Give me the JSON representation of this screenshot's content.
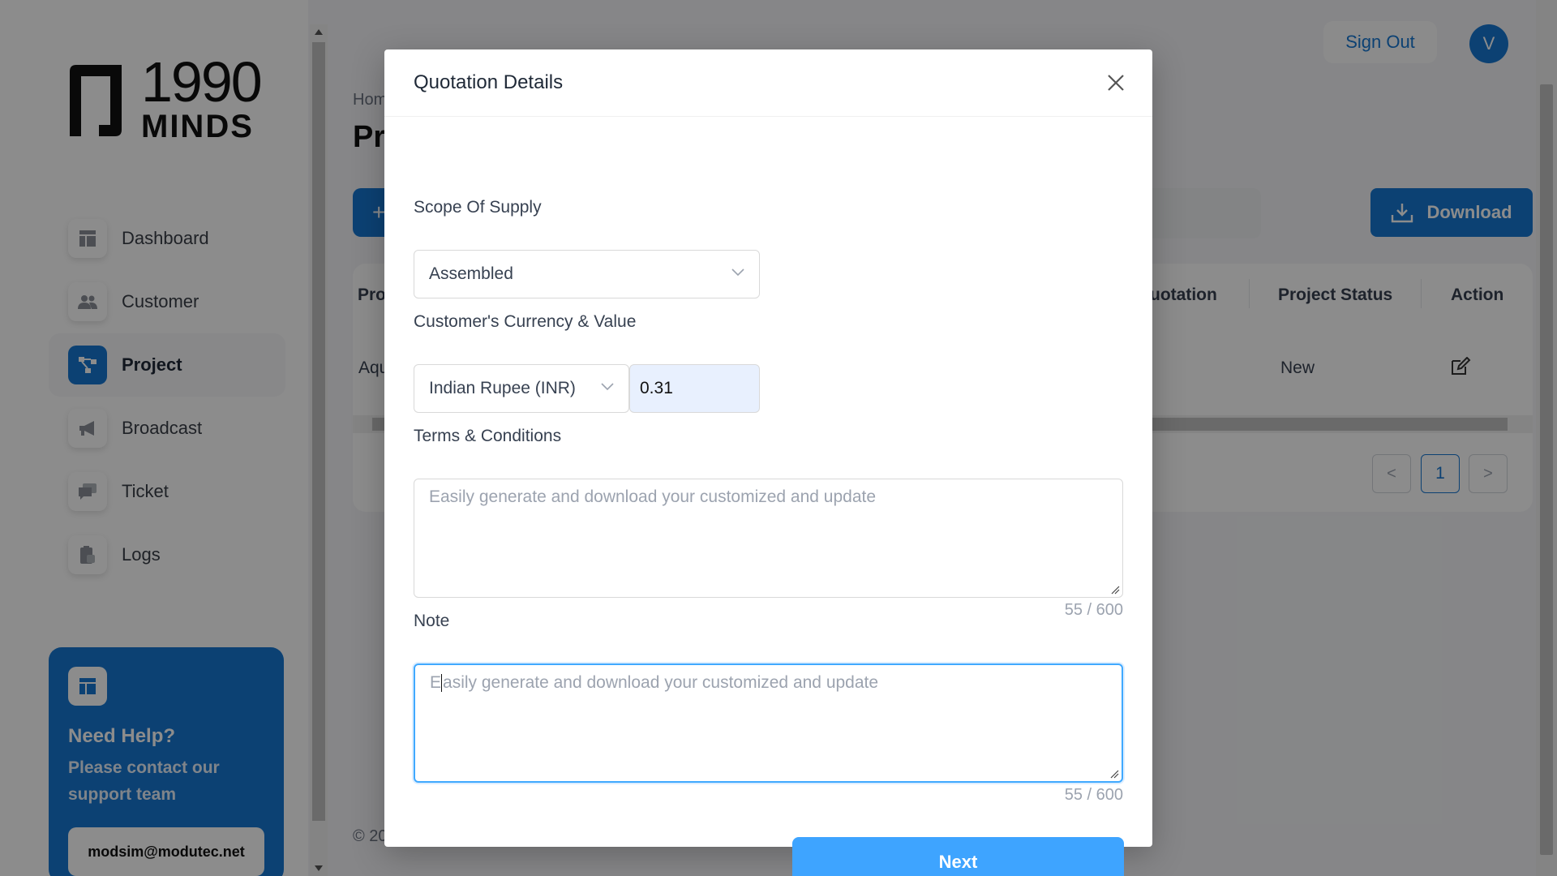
{
  "app": {
    "logo": {
      "number": "1990",
      "word": "MINDS"
    },
    "sidebar": {
      "items": [
        {
          "label": "Dashboard",
          "icon": "dashboard-icon",
          "active": false
        },
        {
          "label": "Customer",
          "icon": "users-icon",
          "active": false
        },
        {
          "label": "Project",
          "icon": "project-tree-icon",
          "active": true
        },
        {
          "label": "Broadcast",
          "icon": "megaphone-icon",
          "active": false
        },
        {
          "label": "Ticket",
          "icon": "chat-icon",
          "active": false
        },
        {
          "label": "Logs",
          "icon": "clipboard-icon",
          "active": false
        }
      ],
      "help": {
        "title": "Need Help?",
        "text": "Please contact our support team",
        "email": "modsim@modutec.net"
      }
    },
    "header": {
      "sign_out": "Sign Out",
      "avatar_initial": "V"
    },
    "page": {
      "breadcrumb": "Hom",
      "title": "Pr",
      "add_icon": "+",
      "download_label": "Download",
      "table": {
        "headers": {
          "first": "Pro",
          "quotation": "uotation",
          "status": "Project Status",
          "action": "Action"
        },
        "row": {
          "first": "Aqu",
          "status": "New"
        }
      },
      "pagination": {
        "prev": "<",
        "current": "1",
        "next": ">"
      },
      "copyright": "© 20"
    }
  },
  "modal": {
    "title": "Quotation Details",
    "scope": {
      "label": "Scope Of Supply",
      "value": "Assembled"
    },
    "currency": {
      "label": "Customer's Currency & Value",
      "currency_value": "Indian Rupee (INR)",
      "amount": "0.31"
    },
    "terms": {
      "label": "Terms & Conditions",
      "value": "Easily generate and download your customized and update",
      "counter": "55 / 600"
    },
    "note": {
      "label": "Note",
      "value_first": "E",
      "value_rest": "asily generate and download your customized and update",
      "counter": "55 / 600"
    },
    "next_label": "Next"
  },
  "colors": {
    "primary": "#1677d2",
    "next_button": "#3ea4ff",
    "focus_border": "#40a9ff",
    "autofill_bg": "#e8f0fe"
  }
}
